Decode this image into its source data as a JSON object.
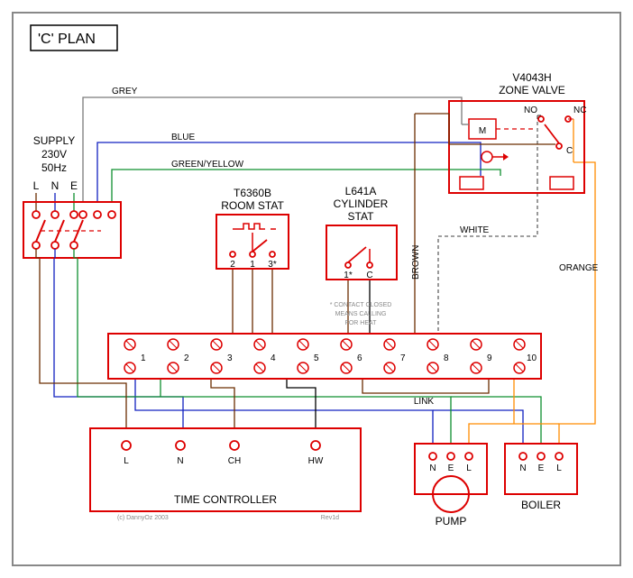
{
  "title": "'C' PLAN",
  "supply": {
    "label1": "SUPPLY",
    "label2": "230V",
    "label3": "50Hz",
    "L": "L",
    "N": "N",
    "E": "E"
  },
  "roomStat": {
    "label1": "T6360B",
    "label2": "ROOM STAT",
    "t1": "2",
    "t2": "1",
    "t3": "3*"
  },
  "cylStat": {
    "label1": "L641A",
    "label2": "CYLINDER",
    "label3": "STAT",
    "t1": "1*",
    "t2": "C",
    "note1": "* CONTACT CLOSED",
    "note2": "MEANS CALLING",
    "note3": "FOR HEAT"
  },
  "zoneValve": {
    "label1": "V4043H",
    "label2": "ZONE VALVE",
    "M": "M",
    "NO": "NO",
    "NC": "NC",
    "C": "C"
  },
  "termBlock": {
    "labels": [
      "1",
      "2",
      "3",
      "4",
      "5",
      "6",
      "7",
      "8",
      "9",
      "10"
    ],
    "link": "LINK"
  },
  "timeController": {
    "label": "TIME CONTROLLER",
    "L": "L",
    "N": "N",
    "CH": "CH",
    "HW": "HW"
  },
  "pump": {
    "label": "PUMP",
    "N": "N",
    "E": "E",
    "L": "L"
  },
  "boiler": {
    "label": "BOILER",
    "N": "N",
    "E": "E",
    "L": "L"
  },
  "wireColors": {
    "grey": "GREY",
    "blue": "BLUE",
    "greenYellow": "GREEN/YELLOW",
    "brown": "BROWN",
    "white": "WHITE",
    "orange": "ORANGE"
  },
  "credits": {
    "copyright": "(c) DannyOz 2003",
    "rev": "Rev1d"
  }
}
